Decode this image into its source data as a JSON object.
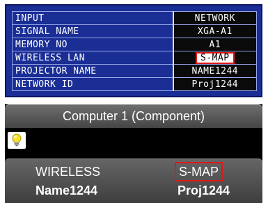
{
  "info_table": {
    "rows": [
      {
        "label": "INPUT",
        "value": "NETWORK"
      },
      {
        "label": "SIGNAL NAME",
        "value": "XGA-A1"
      },
      {
        "label": "MEMORY NO",
        "value": "A1"
      },
      {
        "label": "WIRELESS LAN",
        "value": "S-MAP",
        "highlighted": true
      },
      {
        "label": "PROJECTOR NAME",
        "value": "NAME1244"
      },
      {
        "label": "NETWORK ID",
        "value": "Proj1244"
      }
    ]
  },
  "input_screen": {
    "title": "Computer 1 (Component)",
    "icon": "lightbulb-icon",
    "wireless_label": "WIRELESS",
    "wireless_mode": "S-MAP",
    "projector_name": "Name1244",
    "network_id": "Proj1244"
  },
  "colors": {
    "panel_blue": "#1a2e96",
    "highlight_red": "#e01818",
    "bulb_yellow": "#f4e22a"
  }
}
